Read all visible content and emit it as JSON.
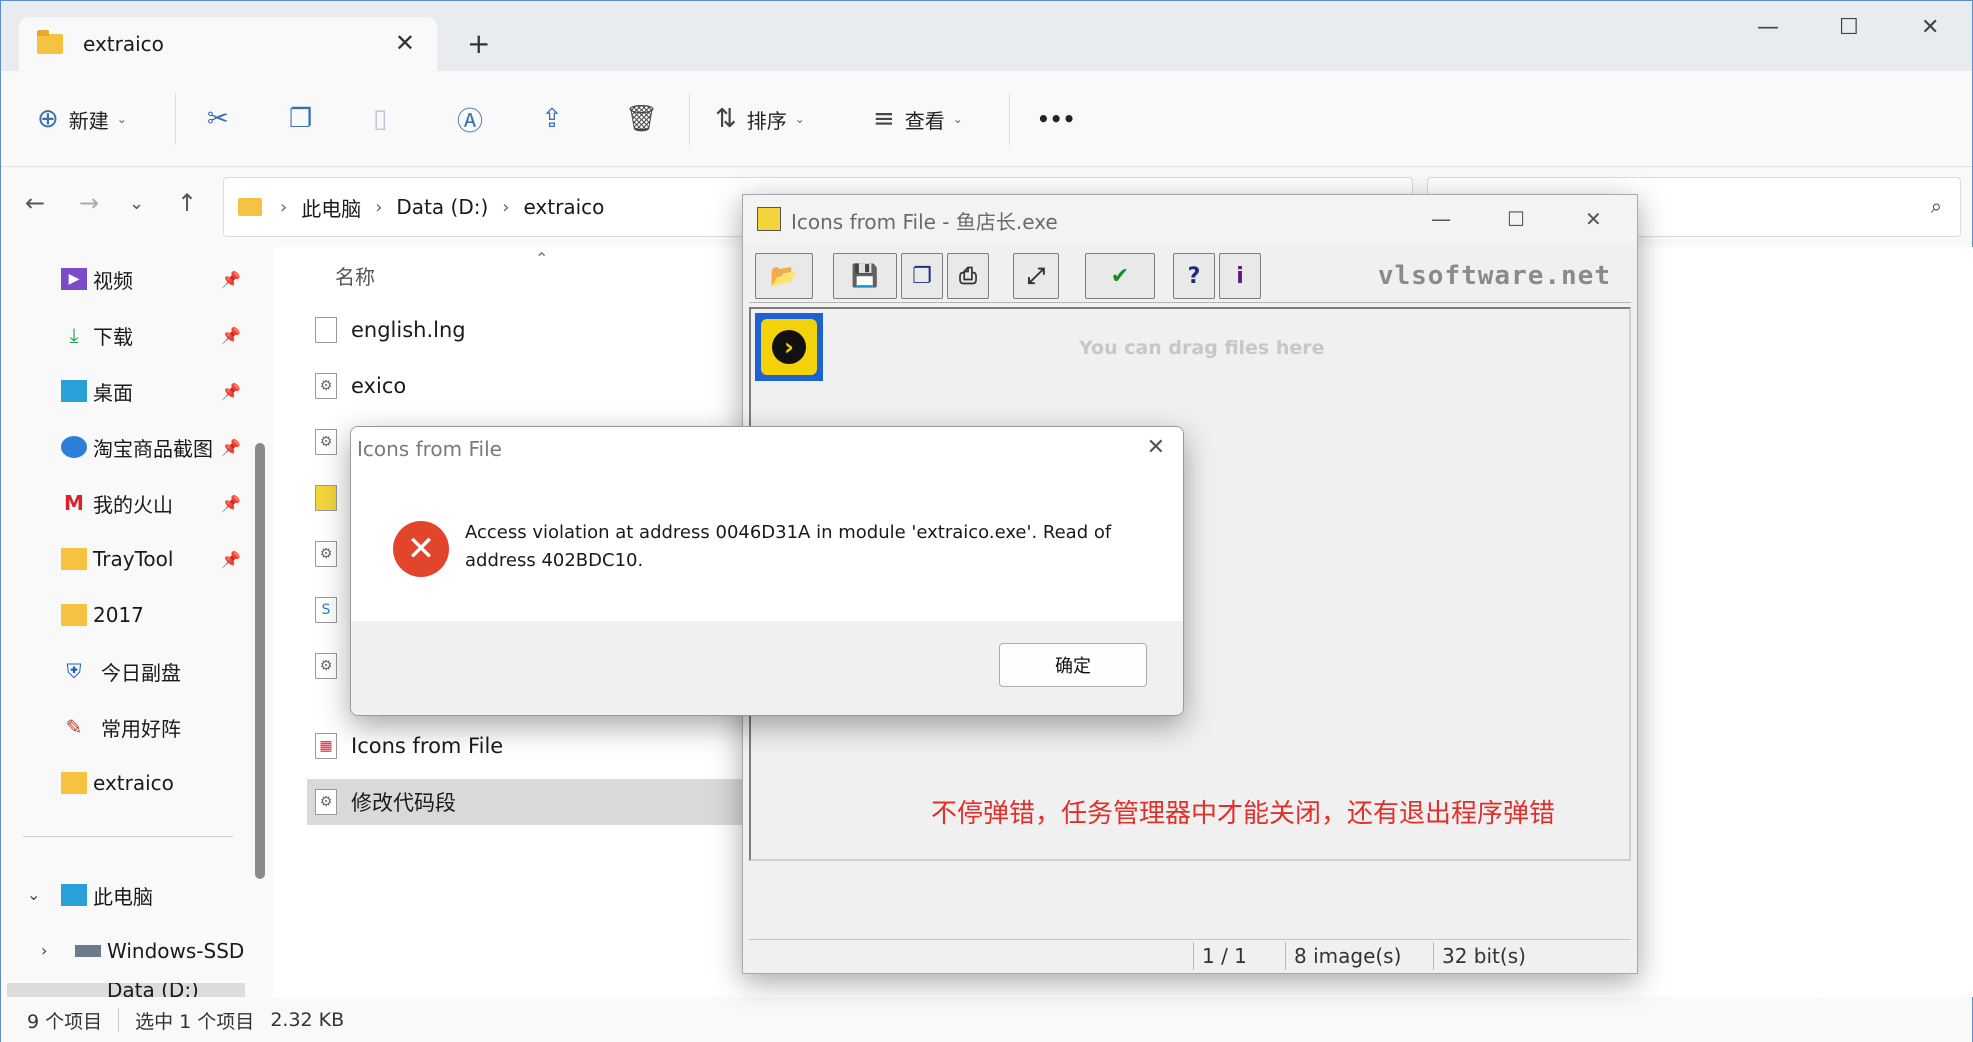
{
  "explorer": {
    "tab_title": "extraico",
    "new_tab": "+",
    "window_controls": {
      "minimize": "—",
      "maximize": "☐",
      "close": "✕"
    },
    "toolbar": {
      "new_label": "新建",
      "sort_label": "排序",
      "view_label": "查看",
      "more": "•••"
    },
    "breadcrumb": [
      "此电脑",
      "Data (D:)",
      "extraico"
    ],
    "breadcrumb_sep": "›",
    "sidebar": {
      "quick": [
        {
          "label": "视频",
          "pinned": true
        },
        {
          "label": "下载",
          "pinned": true
        },
        {
          "label": "桌面",
          "pinned": true
        },
        {
          "label": "淘宝商品截图",
          "pinned": true
        },
        {
          "label": "我的火山",
          "pinned": true
        },
        {
          "label": "TrayTool",
          "pinned": true
        },
        {
          "label": "2017",
          "pinned": false
        },
        {
          "label": "今日副盘",
          "pinned": false
        },
        {
          "label": "常用好阵",
          "pinned": false
        },
        {
          "label": "extraico",
          "pinned": false
        }
      ],
      "this_pc": "此电脑",
      "drives": [
        "Windows-SSD",
        "Data (D:)"
      ]
    },
    "filelist": {
      "column_name": "名称",
      "files": [
        {
          "name": "english.lng",
          "selected": false
        },
        {
          "name": "exico",
          "selected": false
        },
        {
          "name": "",
          "selected": false
        },
        {
          "name": "",
          "selected": false
        },
        {
          "name": "",
          "selected": false
        },
        {
          "name": "",
          "selected": false
        },
        {
          "name": "",
          "selected": false
        },
        {
          "name": "Icons from File",
          "selected": false
        },
        {
          "name": "修改代码段",
          "selected": true
        }
      ]
    },
    "status": {
      "items": "9 个项目",
      "selected": "选中 1 个项目",
      "size": "2.32 KB"
    }
  },
  "icons_window": {
    "title": "Icons from File - 鱼店长.exe",
    "brand": "vlsoftware.net",
    "drop_hint": "You can drag files here",
    "annotation": "不停弹错，任务管理器中才能关闭，还有退出程序弹错",
    "status": {
      "index": "1 / 1",
      "images": "8 image(s)",
      "depth": "32 bit(s)"
    }
  },
  "error_dialog": {
    "title": "Icons from File",
    "message": "Access violation at address 0046D31A in module 'extraico.exe'. Read of address 402BDC10.",
    "ok_label": "确定"
  },
  "colors": {
    "accent": "#1c62d1",
    "error": "#e1462c",
    "annotation": "#e0302c"
  }
}
